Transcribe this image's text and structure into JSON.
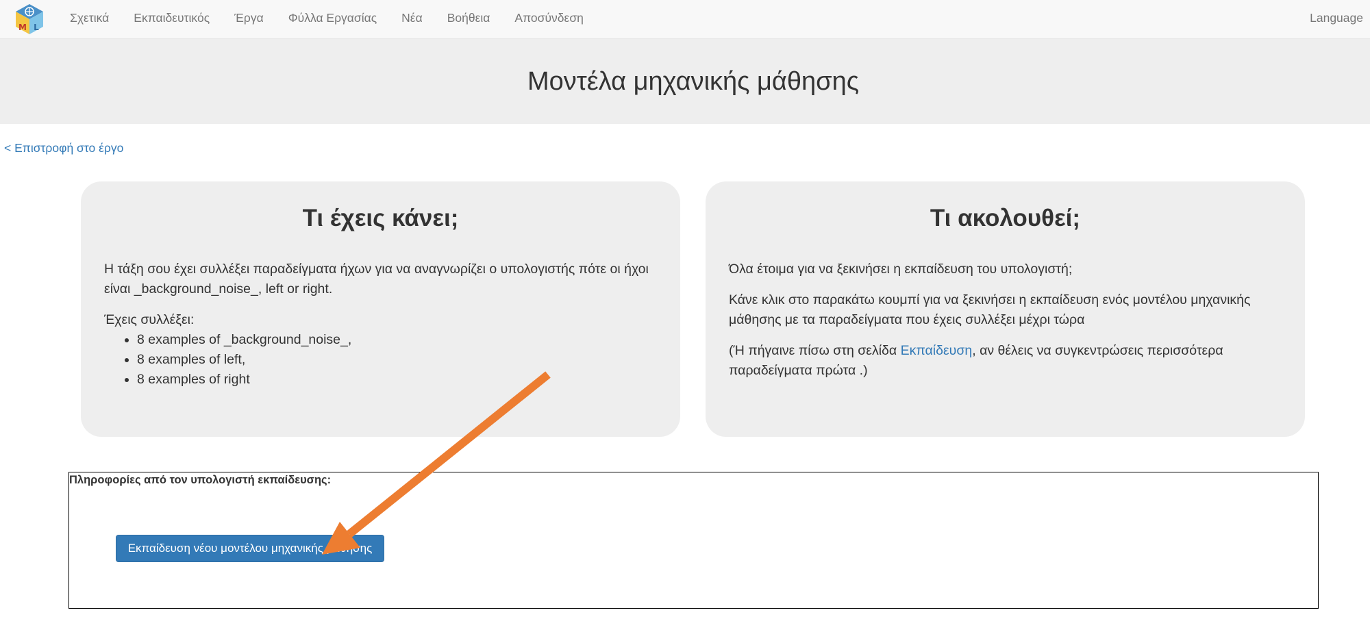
{
  "nav": {
    "logo_icon": "ml-cube-logo-icon",
    "items": [
      "Σχετικά",
      "Εκπαιδευτικός",
      "Έργα",
      "Φύλλα Εργασίας",
      "Νέα",
      "Βοήθεια",
      "Αποσύνδεση"
    ],
    "language": "Language"
  },
  "header": {
    "title": "Μοντέλα μηχανικής μάθησης"
  },
  "back_link": "< Επιστροφή στο έργο",
  "left_panel": {
    "title": "Τι έχεις κάνει;",
    "intro": "Η τάξη σου έχει συλλέξει παραδείγματα ήχων για να αναγνωρίζει ο υπολογιστής πότε οι ήχοι είναι _background_noise_, left or right.",
    "collected_label": "Έχεις συλλέξει:",
    "examples": [
      "8 examples of _background_noise_,",
      "8 examples of left,",
      "8 examples of right"
    ]
  },
  "right_panel": {
    "title": "Τι ακολουθεί;",
    "p1": "Όλα έτοιμα για να ξεκινήσει η εκπαίδευση του υπολογιστή;",
    "p2": "Κάνε κλικ στο παρακάτω κουμπί για να ξεκινήσει η εκπαίδευση ενός μοντέλου μηχανικής μάθησης με τα παραδείγματα που έχεις συλλέξει μέχρι τώρα",
    "p3_before": "(Ή πήγαινε πίσω στη σελίδα ",
    "p3_link": "Εκπαίδευση",
    "p3_after": ", αν θέλεις να συγκεντρώσεις περισσότερα παραδείγματα πρώτα .)"
  },
  "status": {
    "label": "Πληροφορίες από τον υπολογιστή εκπαίδευσης:",
    "train_button": "Εκπαίδευση νέου μοντέλου μηχανικής μάθησης"
  },
  "annotation": {
    "arrow_color": "#ed7d31"
  },
  "colors": {
    "link": "#337ab7",
    "button": "#337ab7",
    "panel": "#eeeeee",
    "navbar": "#f8f8f8"
  }
}
